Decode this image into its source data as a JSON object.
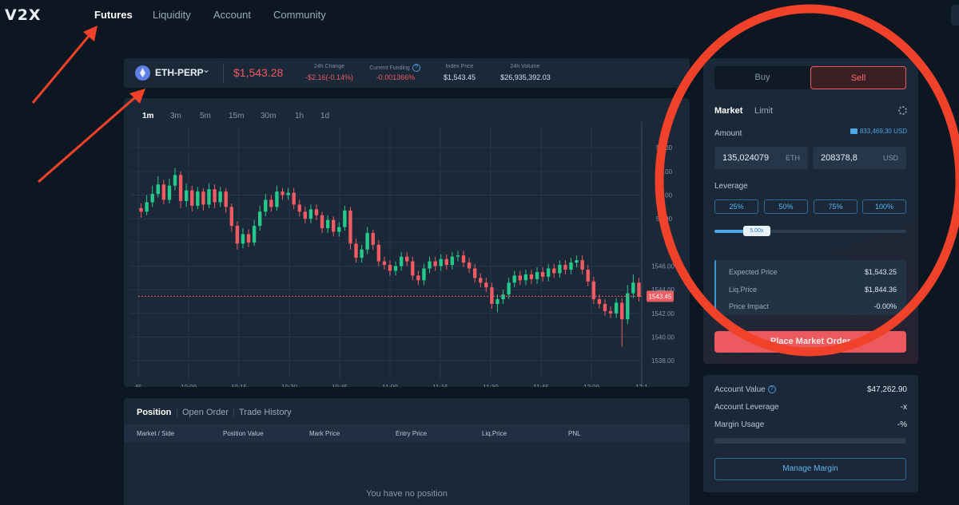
{
  "app": {
    "logo": "V2X"
  },
  "nav": {
    "items": [
      "Futures",
      "Liquidity",
      "Account",
      "Community"
    ],
    "active": "Futures"
  },
  "ticker": {
    "pair": "ETH-PERP",
    "price": "$1,543.28",
    "stats": [
      {
        "label": "24h Change",
        "value": "-$2.16(-0.14%)",
        "negative": true
      },
      {
        "label": "Current Funding",
        "value": "-0.001366%",
        "negative": true
      },
      {
        "label": "Index Price",
        "value": "$1,543.45"
      },
      {
        "label": "24h Volume",
        "value": "$26,935,392.03"
      }
    ]
  },
  "timeframes": [
    "1m",
    "3m",
    "5m",
    "15m",
    "30m",
    "1h",
    "1d"
  ],
  "timeframe_active": "1m",
  "chart_data": {
    "type": "candlestick",
    "y_ticks": [
      "1546.00",
      "1544.00",
      "1542.00",
      "1540.00",
      "1538.00"
    ],
    "y_ticks_partial": [
      "56.00",
      "54.00",
      "52.00",
      "50.00"
    ],
    "x_ticks_partial": [
      "45",
      "10:00",
      "10:15",
      "10:30",
      "10:45",
      "11:00",
      "11:15",
      "11:30",
      "11:45",
      "12:00",
      "12:1"
    ],
    "current_price_label": "1543.45",
    "current_price": 1543.45,
    "colors": {
      "up": "#26c98b",
      "down": "#ef5b63"
    },
    "candles": [
      [
        1550.9,
        1550.6,
        1550.1,
        1551.3
      ],
      [
        1550.6,
        1551.4,
        1550.3,
        1552.0
      ],
      [
        1551.4,
        1552.1,
        1551.0,
        1552.8
      ],
      [
        1552.1,
        1552.9,
        1551.8,
        1553.6
      ],
      [
        1552.9,
        1551.6,
        1551.2,
        1553.3
      ],
      [
        1551.6,
        1552.8,
        1551.3,
        1553.4
      ],
      [
        1552.8,
        1553.7,
        1552.4,
        1554.3
      ],
      [
        1553.7,
        1551.5,
        1550.9,
        1554.0
      ],
      [
        1551.5,
        1552.4,
        1551.0,
        1553.0
      ],
      [
        1552.4,
        1551.1,
        1550.6,
        1552.8
      ],
      [
        1551.1,
        1552.3,
        1550.8,
        1552.7
      ],
      [
        1552.3,
        1551.2,
        1550.7,
        1552.6
      ],
      [
        1551.2,
        1552.5,
        1550.9,
        1553.0
      ],
      [
        1552.5,
        1551.4,
        1550.9,
        1552.9
      ],
      [
        1551.4,
        1552.3,
        1551.0,
        1552.7
      ],
      [
        1552.3,
        1551.0,
        1550.5,
        1552.6
      ],
      [
        1551.0,
        1549.4,
        1548.9,
        1551.3
      ],
      [
        1549.4,
        1547.9,
        1547.4,
        1549.8
      ],
      [
        1547.9,
        1548.7,
        1547.5,
        1549.2
      ],
      [
        1548.7,
        1548.0,
        1547.6,
        1549.1
      ],
      [
        1548.0,
        1549.4,
        1547.7,
        1549.9
      ],
      [
        1549.4,
        1550.6,
        1549.0,
        1551.1
      ],
      [
        1550.6,
        1551.6,
        1550.2,
        1552.1
      ],
      [
        1551.6,
        1551.0,
        1550.6,
        1552.0
      ],
      [
        1551.0,
        1552.3,
        1550.7,
        1552.8
      ],
      [
        1552.3,
        1552.0,
        1551.6,
        1552.6
      ],
      [
        1552.0,
        1552.2,
        1551.6,
        1552.6
      ],
      [
        1552.2,
        1551.2,
        1550.8,
        1552.6
      ],
      [
        1551.2,
        1550.6,
        1550.2,
        1551.6
      ],
      [
        1550.6,
        1550.0,
        1549.6,
        1551.0
      ],
      [
        1550.0,
        1550.8,
        1549.6,
        1551.2
      ],
      [
        1550.8,
        1550.3,
        1549.9,
        1551.2
      ],
      [
        1550.3,
        1549.2,
        1548.8,
        1550.6
      ],
      [
        1549.2,
        1549.9,
        1548.8,
        1550.3
      ],
      [
        1549.9,
        1548.9,
        1548.5,
        1550.2
      ],
      [
        1548.9,
        1549.3,
        1548.5,
        1549.7
      ],
      [
        1549.3,
        1550.7,
        1549.0,
        1551.1
      ],
      [
        1550.7,
        1547.9,
        1547.4,
        1551.0
      ],
      [
        1547.9,
        1546.7,
        1546.3,
        1548.3
      ],
      [
        1546.7,
        1547.4,
        1546.3,
        1547.8
      ],
      [
        1547.4,
        1548.8,
        1547.0,
        1549.3
      ],
      [
        1548.8,
        1547.8,
        1547.4,
        1549.1
      ],
      [
        1547.8,
        1546.4,
        1546.0,
        1548.2
      ],
      [
        1546.4,
        1546.1,
        1545.7,
        1546.8
      ],
      [
        1546.1,
        1545.6,
        1545.2,
        1546.5
      ],
      [
        1545.6,
        1546.0,
        1545.2,
        1546.4
      ],
      [
        1546.0,
        1546.8,
        1545.6,
        1547.2
      ],
      [
        1546.8,
        1546.4,
        1546.0,
        1547.2
      ],
      [
        1546.4,
        1545.2,
        1544.8,
        1546.8
      ],
      [
        1545.2,
        1544.8,
        1544.4,
        1545.6
      ],
      [
        1544.8,
        1545.8,
        1544.4,
        1546.2
      ],
      [
        1545.8,
        1546.4,
        1545.4,
        1546.8
      ],
      [
        1546.4,
        1546.0,
        1545.6,
        1546.8
      ],
      [
        1546.0,
        1546.6,
        1545.6,
        1547.0
      ],
      [
        1546.6,
        1546.1,
        1545.7,
        1547.0
      ],
      [
        1546.1,
        1546.8,
        1545.7,
        1547.2
      ],
      [
        1546.8,
        1546.9,
        1546.4,
        1547.3
      ],
      [
        1546.9,
        1546.3,
        1545.9,
        1547.3
      ],
      [
        1546.3,
        1545.8,
        1545.4,
        1546.7
      ],
      [
        1545.8,
        1545.0,
        1544.6,
        1546.2
      ],
      [
        1545.0,
        1544.6,
        1544.2,
        1545.4
      ],
      [
        1544.6,
        1544.2,
        1543.8,
        1545.0
      ],
      [
        1544.2,
        1542.8,
        1542.4,
        1544.6
      ],
      [
        1542.8,
        1543.2,
        1542.1,
        1543.6
      ],
      [
        1543.2,
        1543.6,
        1542.8,
        1544.0
      ],
      [
        1543.6,
        1544.6,
        1543.2,
        1545.0
      ],
      [
        1544.6,
        1545.2,
        1544.2,
        1545.6
      ],
      [
        1545.2,
        1544.8,
        1544.4,
        1545.6
      ],
      [
        1544.8,
        1545.3,
        1544.4,
        1545.7
      ],
      [
        1545.3,
        1544.9,
        1544.5,
        1545.7
      ],
      [
        1544.9,
        1545.5,
        1544.5,
        1545.9
      ],
      [
        1545.5,
        1545.1,
        1544.7,
        1545.9
      ],
      [
        1545.1,
        1545.8,
        1544.7,
        1546.2
      ],
      [
        1545.8,
        1545.4,
        1545.0,
        1546.2
      ],
      [
        1545.4,
        1546.1,
        1545.0,
        1546.5
      ],
      [
        1546.1,
        1545.7,
        1545.3,
        1546.5
      ],
      [
        1545.7,
        1546.3,
        1545.3,
        1546.7
      ],
      [
        1546.3,
        1546.5,
        1545.9,
        1546.9
      ],
      [
        1546.5,
        1545.7,
        1545.3,
        1546.9
      ],
      [
        1545.7,
        1544.7,
        1544.3,
        1546.1
      ],
      [
        1544.7,
        1543.2,
        1542.8,
        1545.1
      ],
      [
        1543.2,
        1542.8,
        1542.4,
        1543.6
      ],
      [
        1542.8,
        1542.2,
        1541.8,
        1543.2
      ],
      [
        1542.2,
        1542.0,
        1541.6,
        1542.6
      ],
      [
        1542.0,
        1542.9,
        1541.6,
        1543.3
      ],
      [
        1542.9,
        1541.5,
        1539.2,
        1543.3
      ],
      [
        1541.5,
        1543.7,
        1541.1,
        1544.4
      ],
      [
        1543.7,
        1544.6,
        1543.3,
        1545.3
      ],
      [
        1544.6,
        1543.4,
        1543.0,
        1545.0
      ]
    ]
  },
  "positions": {
    "tabs": [
      "Position",
      "Open Order",
      "Trade History"
    ],
    "active": "Position",
    "columns": [
      "Market / Side",
      "Position Value",
      "Mark Price",
      "Entry Price",
      "Liq.Price",
      "PNL"
    ],
    "empty_message": "You have no position"
  },
  "order": {
    "buy_label": "Buy",
    "sell_label": "Sell",
    "active_side": "Sell",
    "type_tabs": [
      "Market",
      "Limit"
    ],
    "active_type": "Market",
    "amount_label": "Amount",
    "balance": "833,469.30 USD",
    "amount_eth": "135,024079",
    "amount_eth_unit": "ETH",
    "amount_usd": "208378,8",
    "amount_usd_unit": "USD",
    "leverage_label": "Leverage",
    "leverage_buttons": [
      "25%",
      "50%",
      "75%",
      "100%"
    ],
    "slider_value": "5.00x",
    "slider_fraction": 0.22,
    "summary": [
      {
        "label": "Expected Price",
        "value": "$1,543.25"
      },
      {
        "label": "Liq.Price",
        "value": "$1,844.36"
      },
      {
        "label": "Price Impact",
        "value": "-0.00%"
      }
    ],
    "place_label": "Place Market Order"
  },
  "account": {
    "rows": [
      {
        "label": "Account Value",
        "value": "$47,262.90"
      },
      {
        "label": "Account Leverage",
        "value": "-x"
      },
      {
        "label": "Margin Usage",
        "value": "-%"
      }
    ],
    "usage_fraction": 0,
    "manage_label": "Manage Margin"
  },
  "annotation_color": "#f0412a"
}
